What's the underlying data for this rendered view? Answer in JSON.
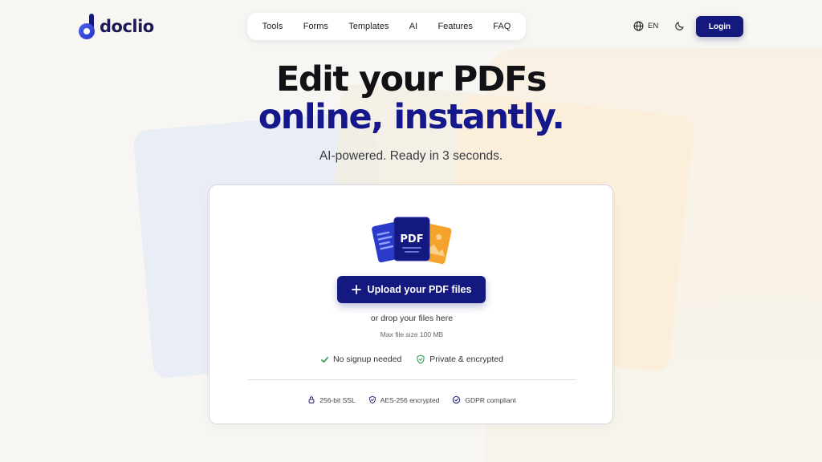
{
  "brand": {
    "name": "doclio"
  },
  "nav": {
    "items": [
      {
        "label": "Tools"
      },
      {
        "label": "Forms"
      },
      {
        "label": "Templates"
      },
      {
        "label": "AI"
      },
      {
        "label": "Features"
      },
      {
        "label": "FAQ"
      }
    ]
  },
  "header": {
    "language": "EN",
    "language_icon": "globe-icon",
    "theme_icon": "moon-icon",
    "login_label": "Login"
  },
  "hero": {
    "title_line1": "Edit your PDFs",
    "title_line2": "online, instantly.",
    "subtitle": "AI-powered. Ready in 3 seconds."
  },
  "upload": {
    "file_badge": "PDF",
    "button_label": "Upload your PDF files",
    "button_icon": "plus-icon",
    "drop_text": "or drop your files here",
    "max_size": "Max file size 100 MB",
    "features": [
      {
        "label": "No signup needed",
        "icon": "check-icon"
      },
      {
        "label": "Private & encrypted",
        "icon": "shield-check-icon"
      }
    ],
    "security": [
      {
        "label": "256-bit SSL",
        "icon": "lock-icon"
      },
      {
        "label": "AES-256 encrypted",
        "icon": "shield-check-icon"
      },
      {
        "label": "GDPR compliant",
        "icon": "check-circle-icon"
      }
    ]
  },
  "colors": {
    "primary": "#141980",
    "title_accent": "#15188a",
    "background": "#f8f6f2",
    "check_green": "#2f9a55",
    "badge_orange": "#f5a32d"
  }
}
